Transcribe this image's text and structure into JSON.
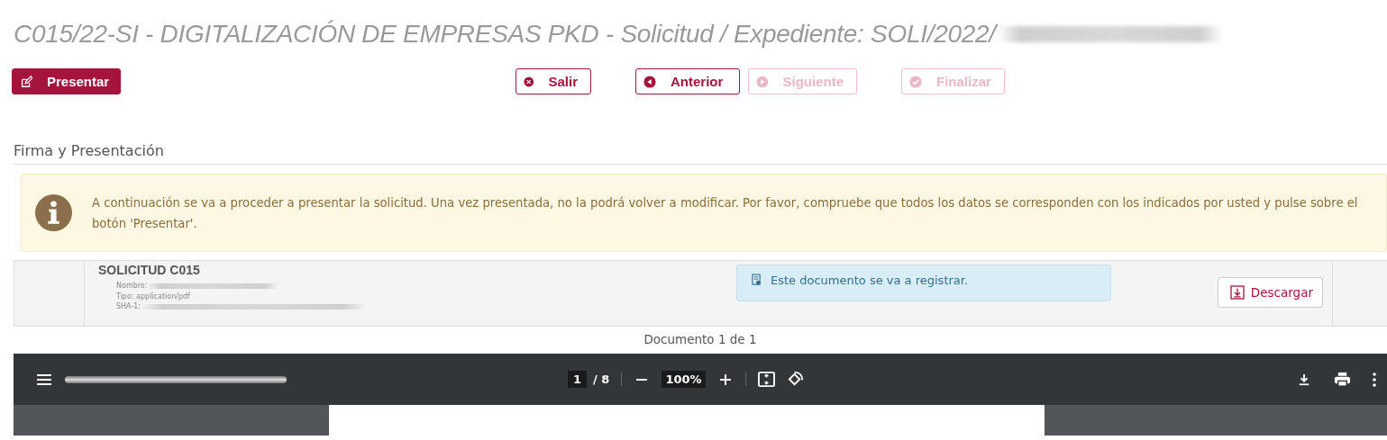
{
  "title": "C015/22-SI - DIGITALIZACIÓN DE EMPRESAS PKD - Solicitud / Expediente: SOLI/2022/",
  "buttons": [
    {
      "label": "Presentar",
      "kind": "submit",
      "disabled": false
    },
    {
      "label": "Salir",
      "kind": "exit",
      "disabled": false
    },
    {
      "label": "Anterior",
      "kind": "previous",
      "disabled": false
    },
    {
      "label": "Siguiente",
      "kind": "next",
      "disabled": true
    },
    {
      "label": "Finalizar",
      "kind": "finish",
      "disabled": true
    }
  ],
  "section_title": "Firma y Presentación",
  "alert": {
    "text": "A continuación se va a proceder a presentar la solicitud. Una vez presentada, no la podrá volver a modificar. Por favor, compruebe que todos los datos se corresponden con los indicados por usted y pulse sobre el botón 'Presentar'."
  },
  "document": {
    "title": "SOLICITUD C015",
    "fields": [
      {
        "label": "Nombre:",
        "redacted": true
      },
      {
        "label": "Tipo: application/pdf",
        "redacted": false
      },
      {
        "label": "SHA-1:",
        "redacted": true
      }
    ],
    "notice": "Este documento se va a registrar.",
    "download_button": "Descargar"
  },
  "document_count": "Documento 1 de 1",
  "pdf_viewer": {
    "page": "1",
    "page_total": "/ 8",
    "zoom": "100%"
  }
}
